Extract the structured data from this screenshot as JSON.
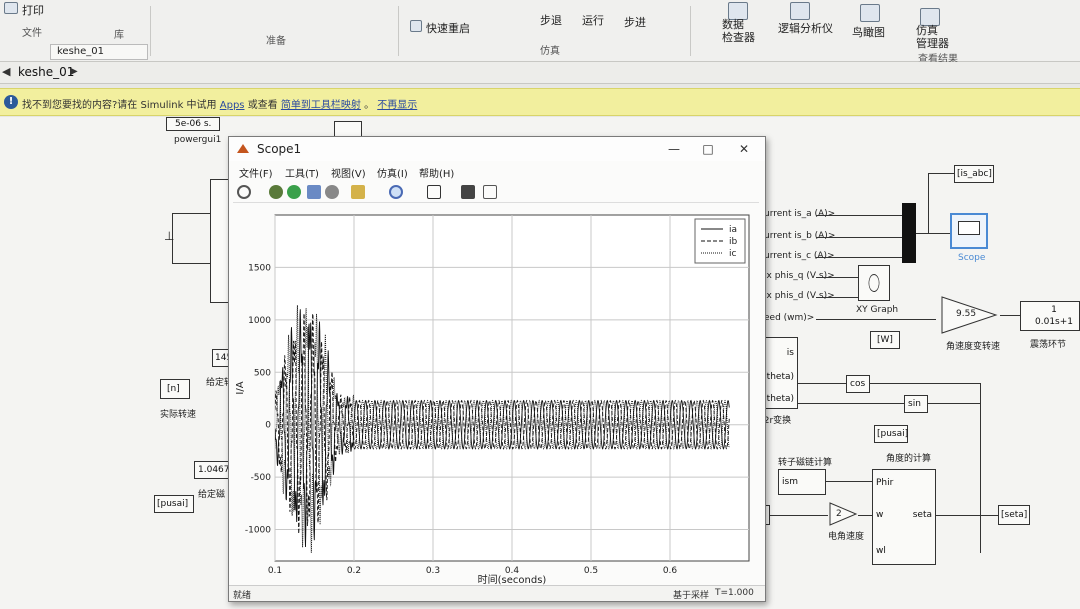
{
  "ribbon": {
    "print_label": "打印",
    "file_section": "文件",
    "lib_section": "库",
    "prepare_section": "准备",
    "quick_restart": "快速重启",
    "step_back": "步退",
    "run": "运行",
    "step_forward": "步进",
    "simulate_section": "仿真",
    "data_inspector": "数据\n检查器",
    "logic_analyzer": "逻辑分析仪",
    "bird_eye": "鸟瞰图",
    "sim_manager": "仿真\n管理器",
    "review_section": "查看结果"
  },
  "tabbar": {
    "tab": "keshe_01",
    "crumb": "keshe_01"
  },
  "infobar": {
    "message": "找不到您要找的内容?请在 Simulink 中试用",
    "link_apps": "Apps",
    "message_mid": "或查看",
    "link_shortcuts": "简单到工具栏映射",
    "link_dismiss": "不再显示"
  },
  "canvas": {
    "powergui_value": "5e-06 s.",
    "powergui_label": "powergui1",
    "const1_value": "145",
    "const1_label": "给定转",
    "from_n": "[n]",
    "from_n_label": "实际转速",
    "const2_value": "1.0467",
    "const2_label": "给定磁",
    "from_pusai": "[pusai]",
    "is_abc": "[is_abc]",
    "scope_label": "Scope",
    "xy_label": "XY Graph",
    "gain_value": "9.55",
    "gain_label": "角速度变转速",
    "tf_value": "1\n0.01s+1",
    "tf_label": "震荡环节",
    "from_w": "[W]",
    "cos_label": "cos",
    "sin_label": "sin",
    "s2_label": "s/2r变换",
    "pusai_out": "[pusai]",
    "flux_calc": "转子磁链计算",
    "angle_calc": "角度的计算",
    "theta_out": "[seta]",
    "gain2_value": "2",
    "gain2_label": "电角速度",
    "sig1": "urrent is_a (A)>",
    "sig2": "urrent is_b (A)>",
    "sig3": "urrent is_c (A)>",
    "sig4": "ix phis_q (V s)>",
    "sig5": "ix phis_d (V s)>",
    "sig6": "eed (wm)>",
    "port_is": "is",
    "port_cos": "cos(theta)",
    "port_sin": "sin(theta)",
    "port_phir": "Phir",
    "port_w": "w",
    "port_wl": "wl",
    "port_seta": "seta",
    "port_ism": "ism",
    "port_m": "m"
  },
  "scope": {
    "title": "Scope1",
    "menu": [
      "文件(F)",
      "工具(T)",
      "视图(V)",
      "仿真(I)",
      "帮助(H)"
    ],
    "status_left": "就绪",
    "status_mid": "基于采样",
    "status_right": "T=1.000",
    "legend_ia": "ia",
    "legend_ib": "ib",
    "legend_ic": "ic"
  },
  "chart_data": {
    "type": "line",
    "title": "",
    "xlabel": "时间(seconds)",
    "ylabel": "I/A",
    "xlim": [
      0.1,
      0.7
    ],
    "ylim": [
      -1300,
      2000
    ],
    "xticks": [
      0.1,
      0.2,
      0.3,
      0.4,
      0.5,
      0.6
    ],
    "yticks": [
      -1000,
      -500,
      0,
      500,
      1000,
      1500
    ],
    "grid": true,
    "legend_position": "top-right",
    "series": [
      {
        "name": "ia",
        "steady_amplitude": 230,
        "transient_peak": 950,
        "settle_time": 0.2,
        "freq_hz": 85,
        "phase_deg": 0
      },
      {
        "name": "ib",
        "steady_amplitude": 230,
        "transient_peak": 900,
        "settle_time": 0.2,
        "freq_hz": 85,
        "phase_deg": -120
      },
      {
        "name": "ic",
        "steady_amplitude": 230,
        "transient_peak": 1000,
        "settle_time": 0.2,
        "freq_hz": 85,
        "phase_deg": 120
      }
    ]
  }
}
